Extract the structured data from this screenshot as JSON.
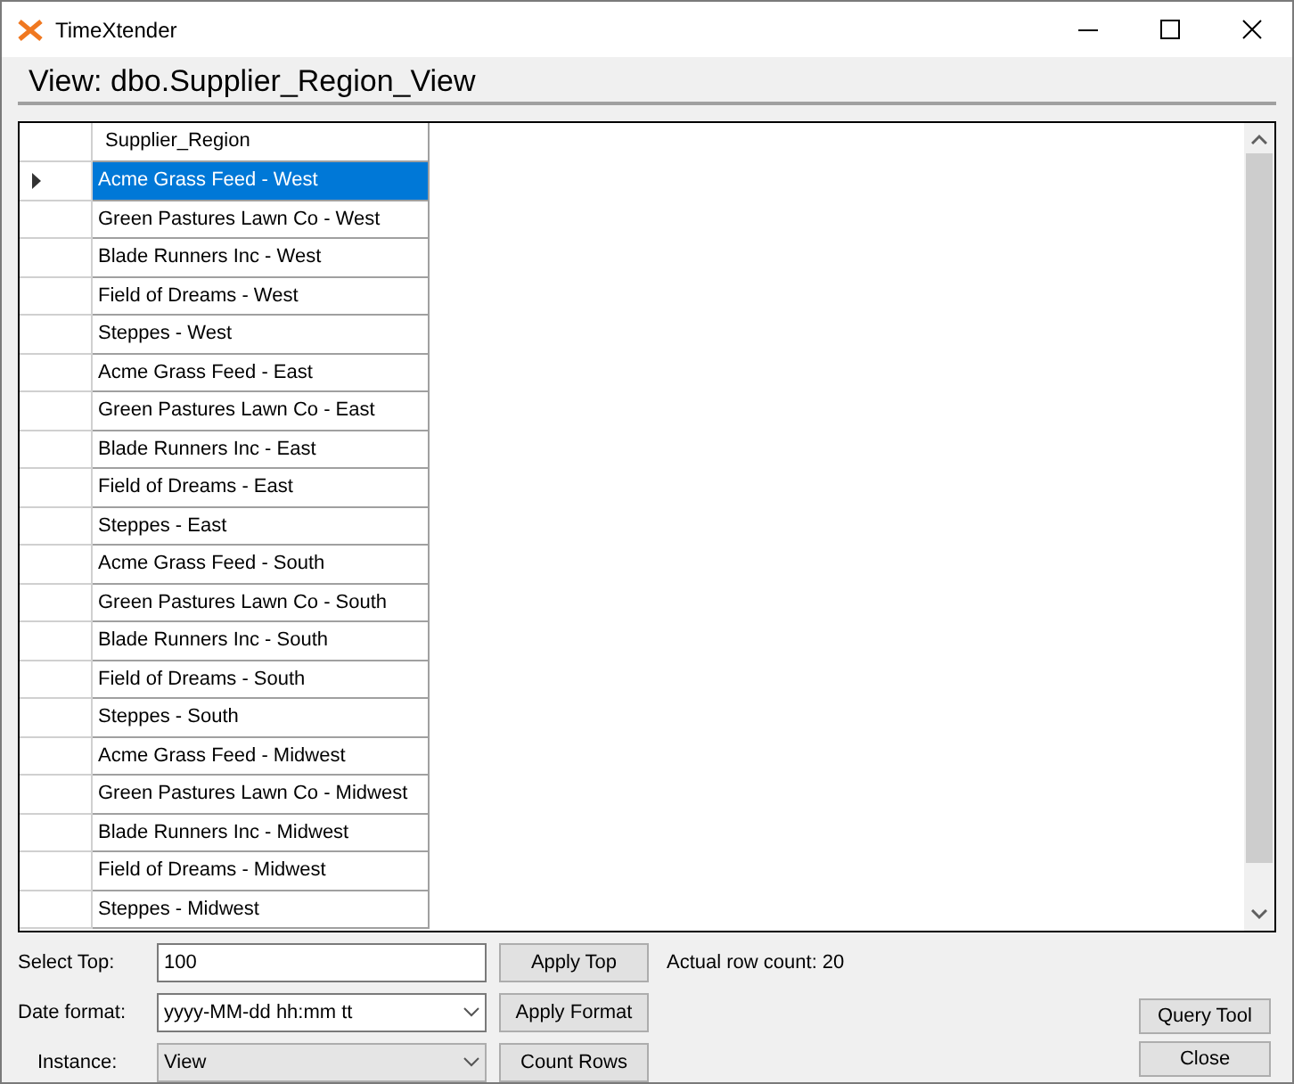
{
  "window": {
    "title": "TimeXtender"
  },
  "heading": "View: dbo.Supplier_Region_View",
  "table": {
    "columns": [
      "Supplier_Region"
    ],
    "rows": [
      {
        "cells": [
          "Acme Grass Feed - West"
        ],
        "selected": true
      },
      {
        "cells": [
          "Green Pastures Lawn Co - West"
        ],
        "selected": false
      },
      {
        "cells": [
          "Blade Runners Inc - West"
        ],
        "selected": false
      },
      {
        "cells": [
          "Field of Dreams - West"
        ],
        "selected": false
      },
      {
        "cells": [
          "Steppes - West"
        ],
        "selected": false
      },
      {
        "cells": [
          "Acme Grass Feed - East"
        ],
        "selected": false
      },
      {
        "cells": [
          "Green Pastures Lawn Co - East"
        ],
        "selected": false
      },
      {
        "cells": [
          "Blade Runners Inc - East"
        ],
        "selected": false
      },
      {
        "cells": [
          "Field of Dreams - East"
        ],
        "selected": false
      },
      {
        "cells": [
          "Steppes - East"
        ],
        "selected": false
      },
      {
        "cells": [
          "Acme Grass Feed - South"
        ],
        "selected": false
      },
      {
        "cells": [
          "Green Pastures Lawn Co - South"
        ],
        "selected": false
      },
      {
        "cells": [
          "Blade Runners Inc - South"
        ],
        "selected": false
      },
      {
        "cells": [
          "Field of Dreams - South"
        ],
        "selected": false
      },
      {
        "cells": [
          "Steppes - South"
        ],
        "selected": false
      },
      {
        "cells": [
          "Acme Grass Feed - Midwest"
        ],
        "selected": false
      },
      {
        "cells": [
          "Green Pastures Lawn Co - Midwest"
        ],
        "selected": false
      },
      {
        "cells": [
          "Blade Runners Inc - Midwest"
        ],
        "selected": false
      },
      {
        "cells": [
          "Field of Dreams - Midwest"
        ],
        "selected": false
      },
      {
        "cells": [
          "Steppes - Midwest"
        ],
        "selected": false
      }
    ]
  },
  "controls": [
    {
      "label": "Select Top:",
      "kind": "text",
      "value": "100",
      "button": "Apply Top",
      "note": "Actual row count: 20"
    },
    {
      "label": "Date format:",
      "kind": "combo",
      "value": "yyyy-MM-dd hh:mm tt",
      "button": "Apply Format"
    },
    {
      "label": "Instance:",
      "kind": "list",
      "value": "View",
      "button": "Count Rows"
    }
  ],
  "side_buttons": [
    "Query Tool",
    "Close"
  ]
}
